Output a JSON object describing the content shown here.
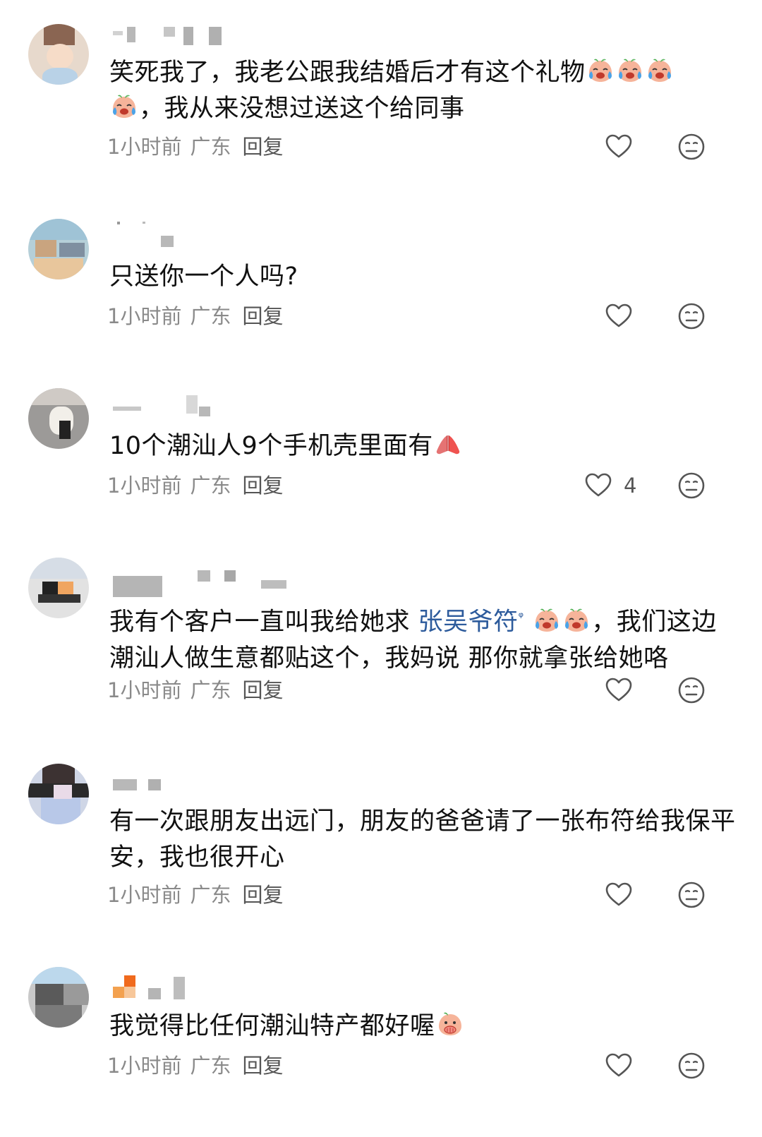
{
  "comments": [
    {
      "text_parts": [
        "笑死我了，我老公跟我结婚后才有这个礼物",
        "，我从来没想过送这个给同事"
      ],
      "time": "1小时前",
      "location": "广东",
      "reply_label": "回复",
      "like_count": ""
    },
    {
      "text_parts": [
        "只送你一个人吗?"
      ],
      "time": "1小时前",
      "location": "广东",
      "reply_label": "回复",
      "like_count": ""
    },
    {
      "text_parts": [
        "10个潮汕人9个手机壳里面有"
      ],
      "time": "1小时前",
      "location": "广东",
      "reply_label": "回复",
      "like_count": "4"
    },
    {
      "text_parts": [
        "我有个客户一直叫我给她求 ",
        "张吴爷符",
        "，我们这边潮汕人做生意都贴这个，我妈说 那你就拿张给她咯"
      ],
      "time": "1小时前",
      "location": "广东",
      "reply_label": "回复",
      "like_count": ""
    },
    {
      "text_parts": [
        "有一次跟朋友出远门，朋友的爸爸请了一张布符给我保平安，我也很开心"
      ],
      "time": "1小时前",
      "location": "广东",
      "reply_label": "回复",
      "like_count": ""
    },
    {
      "text_parts": [
        "我觉得比任何潮汕特产都好喔"
      ],
      "time": "1小时前",
      "location": "广东",
      "reply_label": "回复",
      "like_count": ""
    }
  ],
  "icons": {
    "like": "heart-outline-icon",
    "dislike": "neutral-face-icon",
    "emoji_cry": "crying-laughing-peach-emoji",
    "emoji_pray": "praying-hands-emoji",
    "emoji_cover": "peach-covering-mouth-emoji",
    "mention": "search-magnifier-mark"
  },
  "colors": {
    "text": "#111111",
    "meta": "#8a8a8a",
    "mention": "#2d5b9c",
    "icon": "#555555"
  }
}
